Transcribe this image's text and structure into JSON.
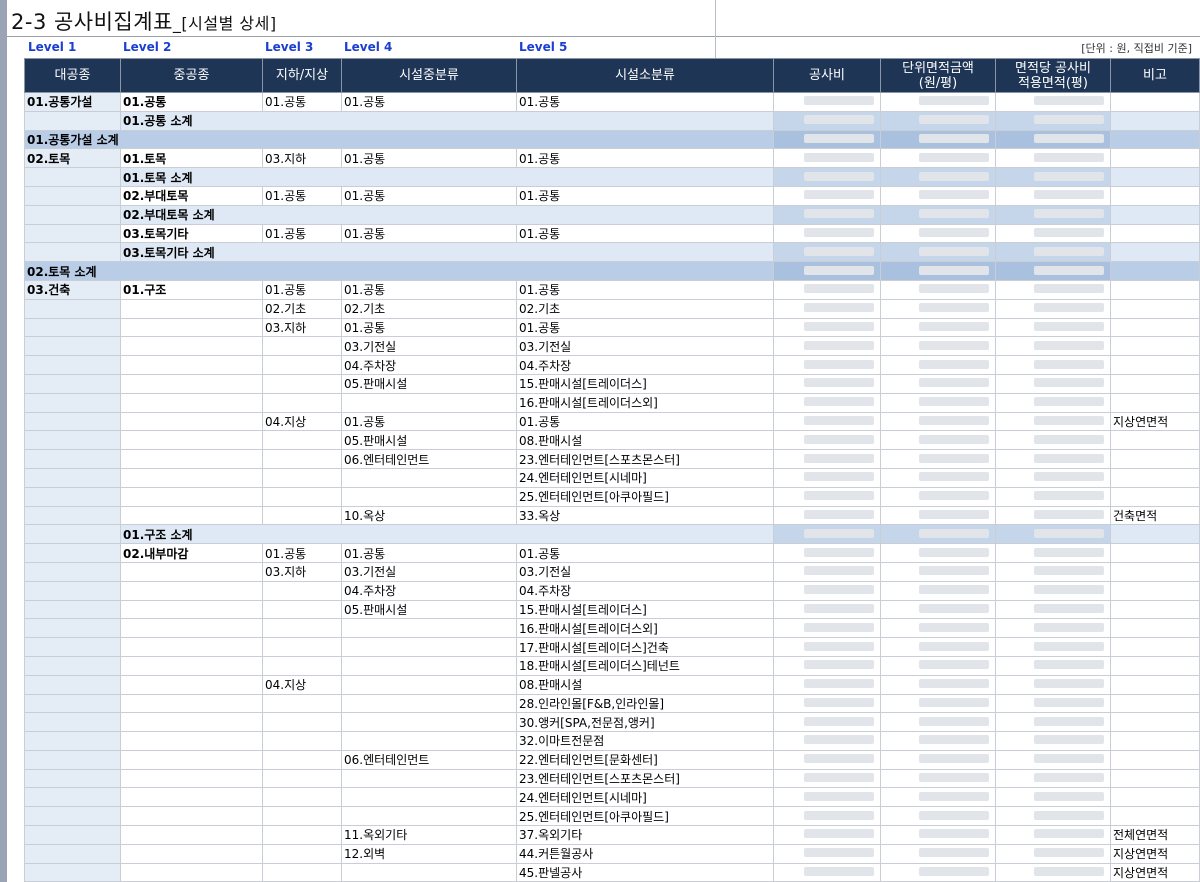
{
  "title": "2-3 공사비집계표",
  "subtitle": "_[시설별 상세]",
  "unit_note": "[단위 : 원, 직접비 기준]",
  "levels": [
    "Level 1",
    "Level 2",
    "Level 3",
    "Level 4",
    "Level 5"
  ],
  "columns": [
    "대공종",
    "중공종",
    "지하/지상",
    "시설중분류",
    "시설소분류",
    "공사비",
    "단위면적금액\n(원/평)",
    "면적당 공사비\n적용면적(평)",
    "비고"
  ],
  "rows": [
    {
      "l1": "01.공통가설",
      "l2": "01.공통",
      "l3": "01.공통",
      "l4": "01.공통",
      "l5": "01.공통",
      "note": ""
    },
    {
      "l2": "01.공통 소계",
      "type": "sub2"
    },
    {
      "l1": "01.공통가설 소계",
      "type": "tot"
    },
    {
      "l1": "02.토목",
      "l2": "01.토목",
      "l3": "03.지하",
      "l4": "01.공통",
      "l5": "01.공통",
      "note": ""
    },
    {
      "l2": "01.토목 소계",
      "type": "sub2"
    },
    {
      "l2": "02.부대토목",
      "l3": "01.공통",
      "l4": "01.공통",
      "l5": "01.공통",
      "note": ""
    },
    {
      "l2": "02.부대토목 소계",
      "type": "sub2"
    },
    {
      "l2": "03.토목기타",
      "l3": "01.공통",
      "l4": "01.공통",
      "l5": "01.공통",
      "note": ""
    },
    {
      "l2": "03.토목기타 소계",
      "type": "sub2"
    },
    {
      "l1": "02.토목 소계",
      "type": "tot"
    },
    {
      "l1": "03.건축",
      "l2": "01.구조",
      "l3": "01.공통",
      "l4": "01.공통",
      "l5": "01.공통",
      "note": ""
    },
    {
      "l3": "02.기초",
      "l4": "02.기초",
      "l5": "02.기초",
      "note": ""
    },
    {
      "l3": "03.지하",
      "l4": "01.공통",
      "l5": "01.공통",
      "note": ""
    },
    {
      "l4": "03.기전실",
      "l5": "03.기전실",
      "note": ""
    },
    {
      "l4": "04.주차장",
      "l5": "04.주차장",
      "note": ""
    },
    {
      "l4": "05.판매시설",
      "l5": "15.판매시설[트레이더스]",
      "note": ""
    },
    {
      "l5": "16.판매시설[트레이더스외]",
      "note": ""
    },
    {
      "l3": "04.지상",
      "l4": "01.공통",
      "l5": "01.공통",
      "note": "지상연면적"
    },
    {
      "l4": "05.판매시설",
      "l5": "08.판매시설",
      "note": ""
    },
    {
      "l4": "06.엔터테인먼트",
      "l5": "23.엔터테인먼트[스포츠몬스터]",
      "note": ""
    },
    {
      "l5": "24.엔터테인먼트[시네마]",
      "note": ""
    },
    {
      "l5": "25.엔터테인먼트[아쿠아필드]",
      "note": ""
    },
    {
      "l4": "10.옥상",
      "l5": "33.옥상",
      "note": "건축면적"
    },
    {
      "l2": "01.구조 소계",
      "type": "sub2"
    },
    {
      "l2": "02.내부마감",
      "l3": "01.공통",
      "l4": "01.공통",
      "l5": "01.공통",
      "note": ""
    },
    {
      "l3": "03.지하",
      "l4": "03.기전실",
      "l5": "03.기전실",
      "note": ""
    },
    {
      "l4": "04.주차장",
      "l5": "04.주차장",
      "note": ""
    },
    {
      "l4": "05.판매시설",
      "l5": "15.판매시설[트레이더스]",
      "note": ""
    },
    {
      "l5": "16.판매시설[트레이더스외]",
      "note": ""
    },
    {
      "l5": "17.판매시설[트레이더스]건축",
      "note": ""
    },
    {
      "l5": "18.판매시설[트레이더스]테넌트",
      "note": ""
    },
    {
      "l3": "04.지상",
      "l5": "08.판매시설",
      "note": ""
    },
    {
      "l5": "28.인라인몰[F&B,인라인몰]",
      "note": ""
    },
    {
      "l5": "30.앵커[SPA,전문점,앵커]",
      "note": ""
    },
    {
      "l5": "32.이마트전문점",
      "note": ""
    },
    {
      "l4": "06.엔터테인먼트",
      "l5": "22.엔터테인먼트[문화센터]",
      "note": ""
    },
    {
      "l5": "23.엔터테인먼트[스포츠몬스터]",
      "note": ""
    },
    {
      "l5": "24.엔터테인먼트[시네마]",
      "note": ""
    },
    {
      "l5": "25.엔터테인먼트[아쿠아필드]",
      "note": ""
    },
    {
      "l4": "11.옥외기타",
      "l5": "37.옥외기타",
      "note": "전체연면적"
    },
    {
      "l4": "12.외벽",
      "l5": "44.커튼월공사",
      "note": "지상연면적"
    },
    {
      "l5": "45.판넬공사",
      "note": "지상연면적"
    }
  ]
}
